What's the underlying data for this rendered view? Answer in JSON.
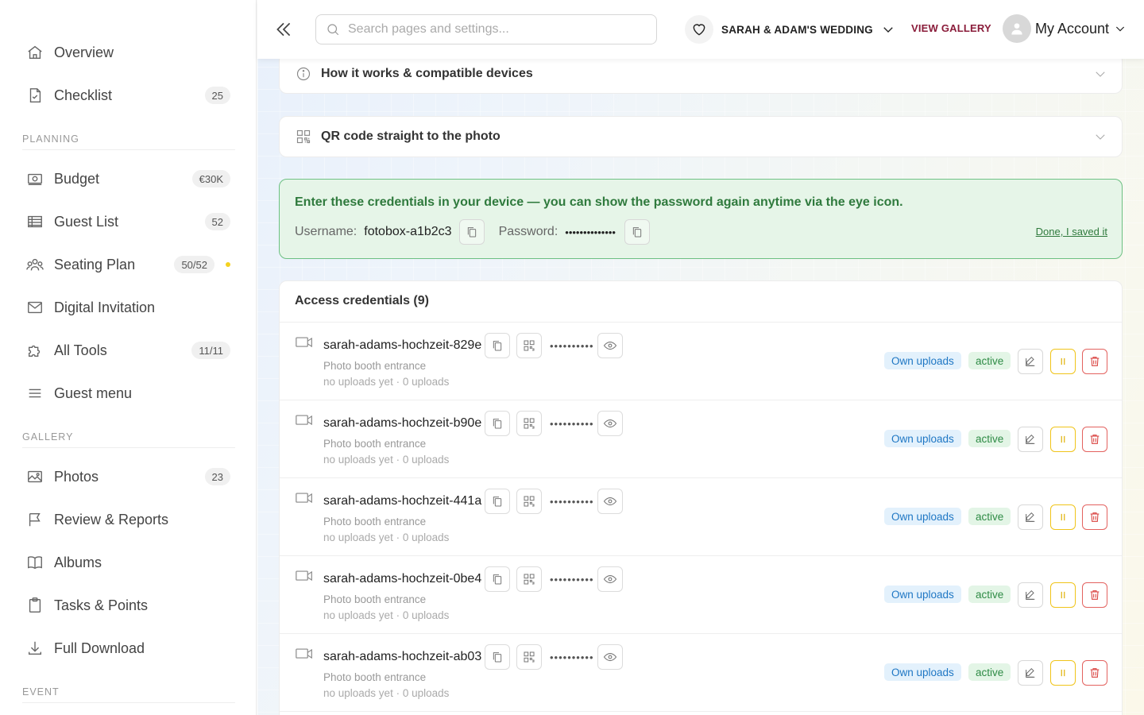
{
  "sidebar": {
    "items": [
      {
        "label": "Overview",
        "icon": "home-icon"
      },
      {
        "label": "Checklist",
        "icon": "checklist-icon",
        "badge": "25"
      },
      {
        "label": "Budget",
        "icon": "budget-icon",
        "badge": "€30K"
      },
      {
        "label": "Guest List",
        "icon": "guest-list-icon",
        "badge": "52"
      },
      {
        "label": "Seating Plan",
        "icon": "seating-icon",
        "badge": "50/52",
        "dot_color": "#f4d21f"
      },
      {
        "label": "Digital Invitation",
        "icon": "mail-icon"
      },
      {
        "label": "All Tools",
        "icon": "puzzle-icon",
        "badge": "11/11"
      },
      {
        "label": "Guest menu",
        "icon": "menu-icon"
      },
      {
        "label": "Photos",
        "icon": "photos-icon",
        "badge": "23"
      },
      {
        "label": "Review & Reports",
        "icon": "flag-icon"
      },
      {
        "label": "Albums",
        "icon": "book-icon"
      },
      {
        "label": "Tasks & Points",
        "icon": "clipboard-icon"
      },
      {
        "label": "Full Download",
        "icon": "download-icon"
      }
    ],
    "sections": {
      "planning": "PLANNING",
      "gallery": "GALLERY",
      "event": "EVENT"
    }
  },
  "header": {
    "search_placeholder": "Search pages and settings...",
    "event_name": "SARAH & ADAM'S WEDDING",
    "view_gallery": "VIEW GALLERY",
    "account": "My Account"
  },
  "accordions": {
    "how_it_works": "How it works & compatible devices",
    "qr_code": "QR code straight to the photo"
  },
  "notice": {
    "text": "Enter these credentials in your device — you can show the password again anytime via the eye icon.",
    "username_label": "Username:",
    "username": "fotobox-a1b2c3",
    "password_label": "Password:",
    "password_mask": "••••••••••••••",
    "done": "Done, I saved it"
  },
  "credentials": {
    "title": "Access credentials (9)",
    "rows": [
      {
        "name": "sarah-adams-hochzeit-829e",
        "mask": "••••••••••",
        "location": "Photo booth entrance",
        "stats": "no uploads yet · 0 uploads",
        "scope": "Own uploads",
        "status": "active"
      },
      {
        "name": "sarah-adams-hochzeit-b90e",
        "mask": "••••••••••",
        "location": "Photo booth entrance",
        "stats": "no uploads yet · 0 uploads",
        "scope": "Own uploads",
        "status": "active"
      },
      {
        "name": "sarah-adams-hochzeit-441a",
        "mask": "••••••••••",
        "location": "Photo booth entrance",
        "stats": "no uploads yet · 0 uploads",
        "scope": "Own uploads",
        "status": "active"
      },
      {
        "name": "sarah-adams-hochzeit-0be4",
        "mask": "••••••••••",
        "location": "Photo booth entrance",
        "stats": "no uploads yet · 0 uploads",
        "scope": "Own uploads",
        "status": "active"
      },
      {
        "name": "sarah-adams-hochzeit-ab03",
        "mask": "••••••••••",
        "location": "Photo booth entrance",
        "stats": "no uploads yet · 0 uploads",
        "scope": "Own uploads",
        "status": "active"
      }
    ]
  },
  "colors": {
    "brand": "#8a1c3a",
    "success": "#2f7a3d",
    "info": "#1f77c4",
    "warning": "#f0c419",
    "danger": "#d9423f"
  }
}
